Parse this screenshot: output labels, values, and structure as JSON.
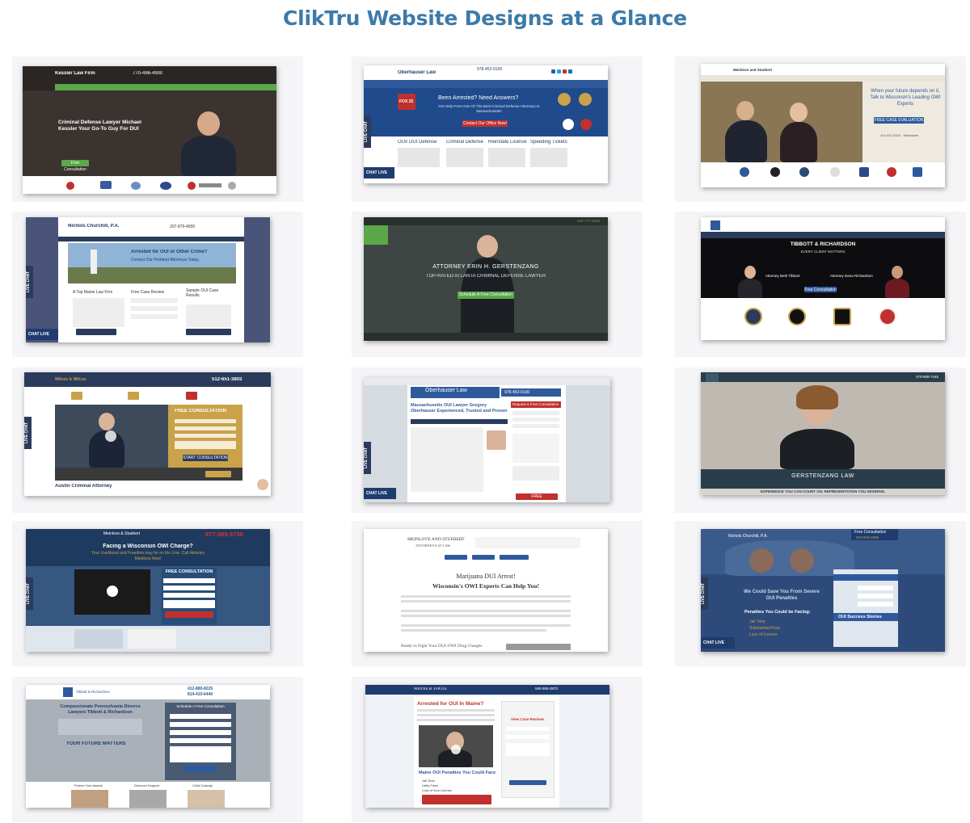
{
  "page": {
    "title": "ClikTru Website Designs at a Glance"
  },
  "designs": [
    {
      "name": "Kessler Law Firm",
      "phone": "770-496-4900",
      "headline": "Criminal Defense Lawyer Michael Kessler Your Go-To Guy For DUI",
      "button": "Free Consultation"
    },
    {
      "name": "Oberhauser Law",
      "phone": "978-452-9100",
      "headline": "Been Arrested? Need Answers?",
      "subhead": "Get Help From One Of The Best Criminal Defense Attorneys In Massachusetts!",
      "button": "Contact Our Office Now!",
      "columns": [
        "OUI/ DUI Defense",
        "Criminal Defense",
        "Reinstate License",
        "Speeding Tickets"
      ],
      "chat": "CHAT LIVE",
      "badge": "FOX 25",
      "side": "LIVE CHAT"
    },
    {
      "name": "Meinlove and Stuebert",
      "headline": "When your future depends on it, Talk to Wisconsin's Leading OWI Experts",
      "button": "FREE CASE EVALUATION",
      "phone": "414-921-6464 · Milwaukee"
    },
    {
      "name": "Nichols Churchill, P.A.",
      "phone": "207-879-4000",
      "headline": "Arrested for OUI or Other Crime?",
      "subhead": "Contact Our Portland Attorneys Today.",
      "columns": [
        "A Top Maine Law Firm",
        "Free Case Review",
        "Sample OUI Case Results"
      ],
      "chat": "CHAT LIVE",
      "side": "LIVE CHAT"
    },
    {
      "name": "Attorney Erin H. Gerstenzang",
      "headline": "ATTORNEY ERIN H. GERSTENZANG",
      "subhead": "TOP-RATED ATLANTA CRIMINAL DEFENSE LAWYER",
      "button": "Schedule A Free Consultation",
      "phone": "404-777-4246"
    },
    {
      "name": "TIBBOTT & RICHARDSON",
      "tagline": "EVERY CLIENT MATTERS",
      "attorneys": [
        "Attorney Beth Tibbott",
        "Attorney Dana Richardson"
      ],
      "button": "Free Consultation"
    },
    {
      "name": "Wilcox & Wilcox",
      "phone": "512-651-3803",
      "headline": "FREE CONSULTATION",
      "footer": "Austin Criminal Attorney",
      "side": "LIVE CHAT",
      "button": "START CONSULTATION"
    },
    {
      "name": "Oberhauser Law",
      "phone": "978-452-9100",
      "headline": "Massachusetts OUI Lawyer Gregory Oberhauser Experienced, Trusted and Proven",
      "form": "Request a Free Consultation",
      "chat": "CHAT LIVE",
      "side": "LIVE CHAT",
      "button": "FREE CONSULTATION"
    },
    {
      "name": "GERSTENZANG LAW",
      "tagline": "EXPERIENCE YOU CAN COUNT ON. REPRESENTATION YOU DESERVE.",
      "phone": "470-908-7445"
    },
    {
      "name": "Meinlove & Stuebert",
      "phone": "877-389-3738",
      "headline": "Facing a Wisconsin OWI Charge?",
      "subhead": "Your Livelihood and Freedom may be on the Line. Call Attorney Meinlove Now!",
      "form": "FREE CONSULTATION",
      "side": "LIVE CHAT"
    },
    {
      "name": "MEINLOVE AND STUEBERT",
      "subname": "ATTORNEYS AT LAW",
      "headline": "Marijuana DUI Arrest!",
      "subhead": "Wisconsin's OWI Experts Can Help You!",
      "footer": "Ready to Fight Your DUI-OWI Drug Charges"
    },
    {
      "name": "Nichols Churchill, P.A.",
      "form": "Free Consultation",
      "phone": "207-879-4000",
      "headline": "We Could Save You From Severe OUI Penalties",
      "subhead": "Penalties You Could be Facing:",
      "list": [
        "Jail Time",
        "Substantial Fines",
        "Loss of License"
      ],
      "panel": "OUI Success Stories",
      "side": "LIVE CHAT",
      "chat": "CHAT LIVE"
    },
    {
      "name": "Tibbott & Richardson",
      "phone": "412-880-8225",
      "phone2": "814-410-6440",
      "headline": "Compassionate Pennsylvania Divorce Lawyers Tibbott & Richardson",
      "subhead": "YOUR FUTURE MATTERS",
      "form": "Schedule A Free Consultation",
      "columns": [
        "Protect Your Assets",
        "Divorced Support",
        "Child Custody"
      ]
    },
    {
      "name": "WAYNE R. FOOTE",
      "phone": "590-906-3870",
      "headline": "Arrested for OUI In Maine?",
      "form": "View Case Reviews",
      "footer": "Maine OUI Penalties You Could Face",
      "list": [
        "Jail Time",
        "Hefty Fines",
        "Loss of Your License"
      ]
    }
  ],
  "colors": {
    "title": "#3c7aa8",
    "kessler_green": "#5aa84a",
    "navy": "#1f3c6e",
    "slate": "#4a5478",
    "red": "#c0302e",
    "gold": "#c9a24a"
  }
}
